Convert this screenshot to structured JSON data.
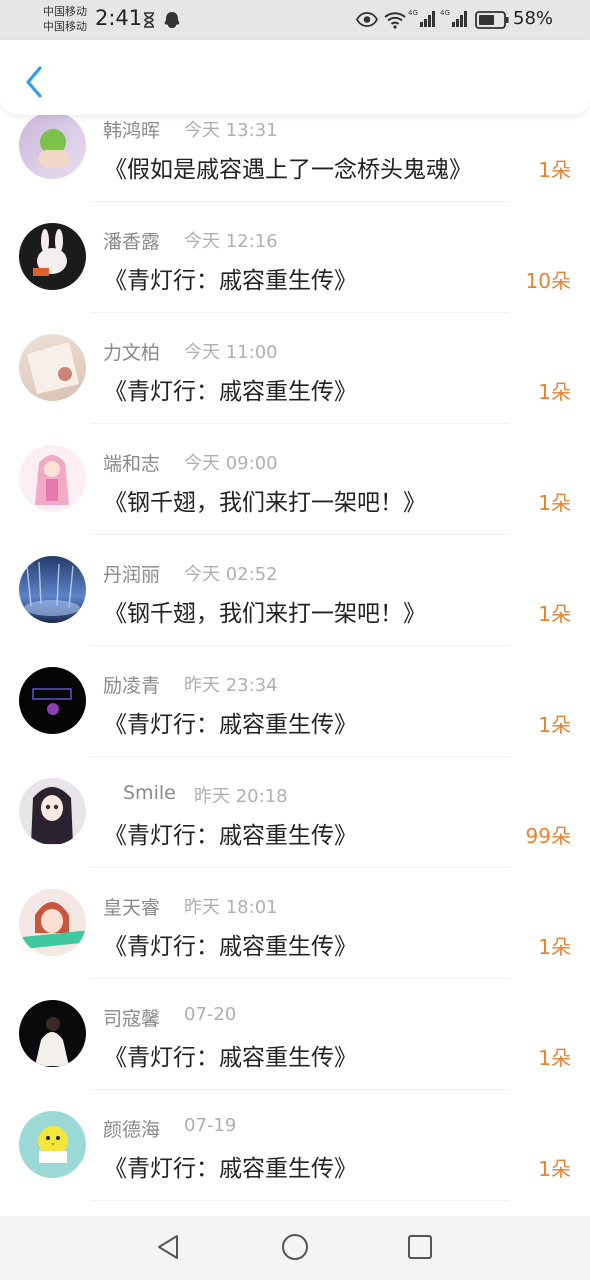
{
  "status_bar": {
    "carrier_1": "中国移动",
    "carrier_2": "中国移动",
    "time": "2:41",
    "battery": "58%",
    "icons": [
      "hourglass-icon",
      "notification-icon",
      "eye-icon",
      "wifi-icon",
      "signal-icon",
      "signal-icon",
      "battery-icon"
    ]
  },
  "header": {
    "back_icon": "chevron-left-icon",
    "accent": "#2a9df4"
  },
  "gifts": [
    {
      "name": "韩鸿晖",
      "time": "今天 13:31",
      "book": "《假如是戚容遇上了一念桥头鬼魂》",
      "count": "1朵"
    },
    {
      "name": "潘香露",
      "time": "今天 12:16",
      "book": "《青灯行：戚容重生传》",
      "count": "10朵"
    },
    {
      "name": "力文柏",
      "time": "今天 11:00",
      "book": "《青灯行：戚容重生传》",
      "count": "1朵"
    },
    {
      "name": "端和志",
      "time": "今天 09:00",
      "book": "《钢千翅，我们来打一架吧！》",
      "count": "1朵"
    },
    {
      "name": "丹润丽",
      "time": "今天 02:52",
      "book": "《钢千翅，我们来打一架吧！》",
      "count": "1朵"
    },
    {
      "name": "励凌青",
      "time": "昨天 23:34",
      "book": "《青灯行：戚容重生传》",
      "count": "1朵"
    },
    {
      "name": "Smile",
      "time": "昨天 20:18",
      "book": "《青灯行：戚容重生传》",
      "count": "99朵"
    },
    {
      "name": "皇天睿",
      "time": "昨天 18:01",
      "book": "《青灯行：戚容重生传》",
      "count": "1朵"
    },
    {
      "name": "司寇馨",
      "time": "07-20",
      "book": "《青灯行：戚容重生传》",
      "count": "1朵"
    },
    {
      "name": "颜德海",
      "time": "07-19",
      "book": "《青灯行：戚容重生传》",
      "count": "1朵"
    }
  ],
  "nav": {
    "icons": [
      "back-triangle-icon",
      "home-circle-icon",
      "recents-square-icon"
    ]
  },
  "colors": {
    "count": "#e8822e",
    "name": "#8a8a8a",
    "time": "#b0b0b0"
  }
}
